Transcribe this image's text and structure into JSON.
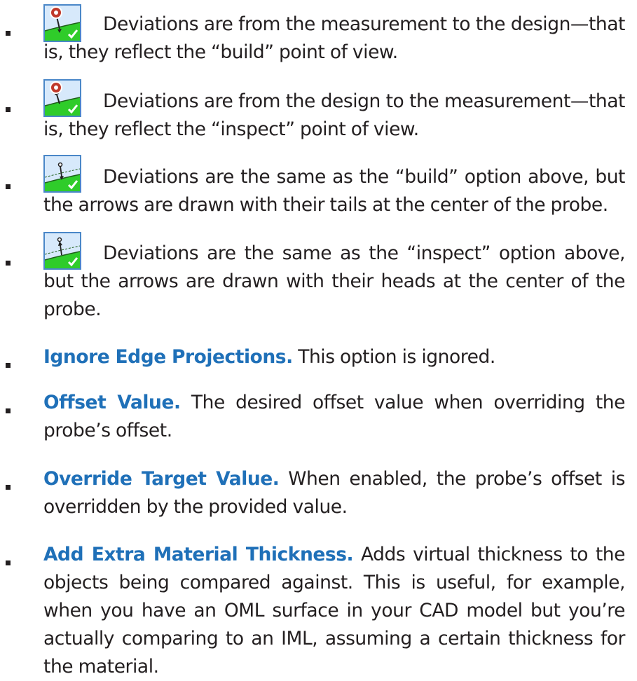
{
  "items": [
    {
      "type": "icon",
      "icon": "build-deviation-icon",
      "text": "Deviations are from the measurement to the design—that is, they reflect the “build” point of view."
    },
    {
      "type": "icon",
      "icon": "inspect-deviation-icon",
      "text": "Deviations are from the design to the measurement—that is, they reflect the “inspect” point of view."
    },
    {
      "type": "icon",
      "icon": "build-arrow-tails-icon",
      "text": "Deviations are the same as the “build” option above, but the arrows are drawn with their tails at the center of the probe."
    },
    {
      "type": "icon",
      "icon": "inspect-arrow-heads-icon",
      "text": "Deviations are the same as the “inspect” option above, but the arrows are drawn with their heads at the center of the probe."
    },
    {
      "type": "term",
      "term": "Ignore Edge Projections.",
      "text": "This option is ignored."
    },
    {
      "type": "term",
      "term": "Offset Value.",
      "text": "The desired offset value when overriding the probe’s offset."
    },
    {
      "type": "term",
      "term": "Override Target Value.",
      "text": "When enabled, the probe’s offset is overridden by the provided value."
    },
    {
      "type": "term",
      "term": "Add Extra Material Thickness.",
      "text": "Adds virtual thickness to the objects being compared against. This is useful, for example, when you have an OML surface in your CAD model but you’re actually comparing to an IML, assuming a certain thickness for the material."
    }
  ],
  "colors": {
    "term": "#1f70b8",
    "body_text": "#231f20",
    "icon_border": "#4a87c8",
    "icon_fill": "#d7e9fb",
    "surface_green": "#2fcc2a"
  }
}
